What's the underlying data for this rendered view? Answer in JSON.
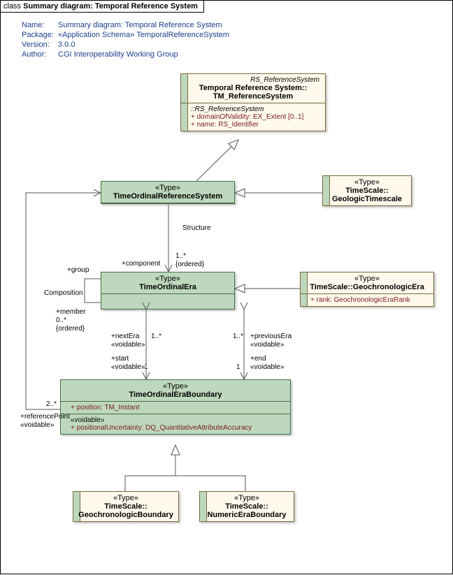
{
  "title_prefix": "class ",
  "title_bold": "Summary diagram: Temporal Reference System",
  "meta": {
    "name_key": "Name:",
    "name": "Summary diagram: Temporal Reference System",
    "package_key": "Package:",
    "package": "«Application Schema» TemporalReferenceSystem",
    "version_key": "Version:",
    "version": "3.0.0",
    "author_key": "Author:",
    "author": "CGI Interoperability Working Group"
  },
  "boxes": {
    "tmref": {
      "stereotype_top": "RS_ReferenceSystem",
      "name1": "Temporal Reference System::",
      "name2": "TM_ReferenceSystem",
      "sect_label": "::RS_ReferenceSystem",
      "a1": "domainOfValidity:  EX_Extent [0..1]",
      "a2": "name:  RS_Identifier"
    },
    "tors": {
      "stereo": "«Type»",
      "name": "TimeOrdinalReferenceSystem"
    },
    "gts": {
      "stereo": "«Type»",
      "name1": "TimeScale::",
      "name2": "GeologicTimescale"
    },
    "toe": {
      "stereo": "«Type»",
      "name": "TimeOrdinalEra"
    },
    "gce": {
      "stereo": "«Type»",
      "name": "TimeScale::GeochronologicEra",
      "a1": "rank:  GeochronologicEraRank"
    },
    "toeb": {
      "stereo": "«Type»",
      "name": "TimeOrdinalEraBoundary",
      "a1": "position:  TM_Instant",
      "sect2": "«voidable»",
      "a2": "positionalUncertainty:  DQ_QuantitativeAttributeAccuracy"
    },
    "gcb": {
      "stereo": "«Type»",
      "name1": "TimeScale::",
      "name2": "GeochronologicBoundary"
    },
    "neb": {
      "stereo": "«Type»",
      "name1": "TimeScale::",
      "name2": "NumericEraBoundary"
    }
  },
  "labels": {
    "structure": "Structure",
    "component": "+component",
    "ord1": "{ordered}",
    "mult1": "1..*",
    "group": "+group",
    "composition": "Composition",
    "member": "+member",
    "mult0": "0..*",
    "ord2": "{ordered}",
    "nextEra": "+nextEra",
    "prevEra": "+previousEra",
    "voidable": "«voidable»",
    "start": "+start",
    "end": "+end",
    "mult_1": "1",
    "mult_1s": "1..*",
    "refPoint": "+referencePoint",
    "mult2": "2..*"
  }
}
